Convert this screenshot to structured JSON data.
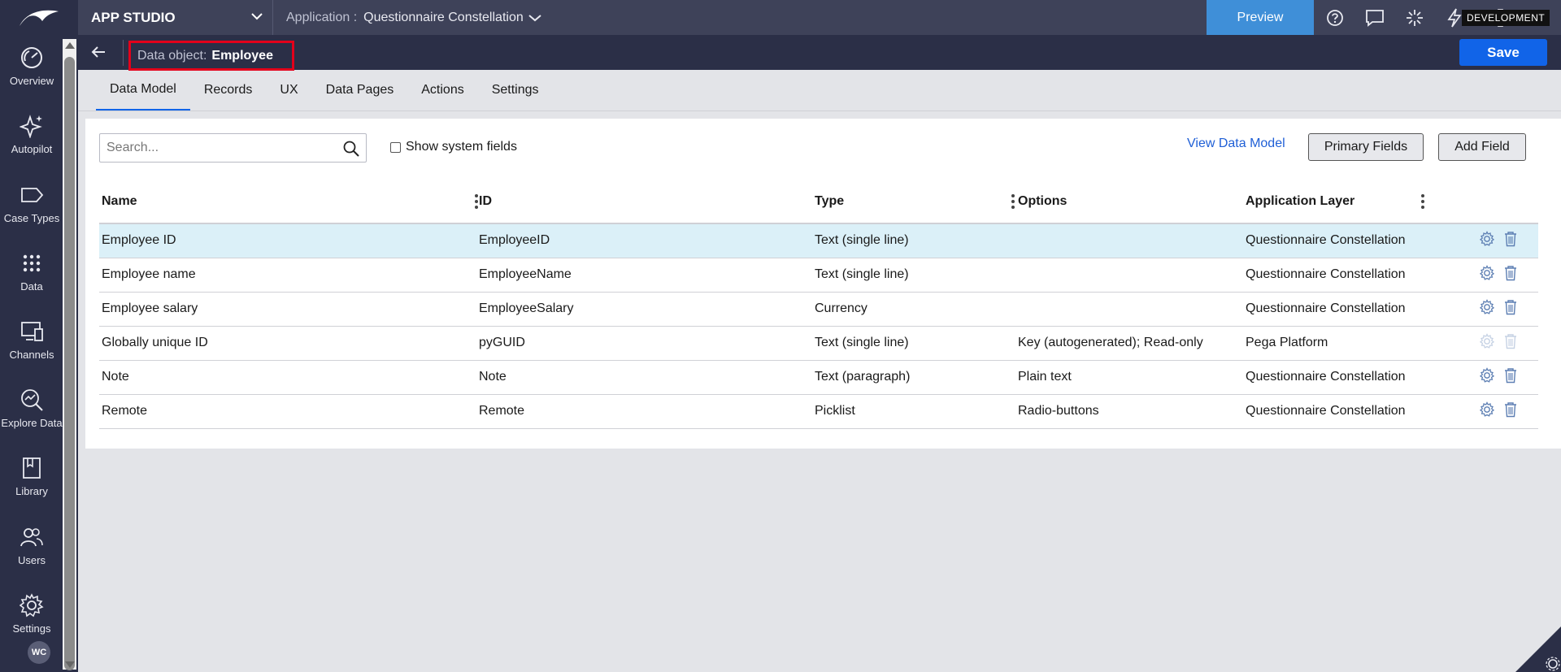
{
  "leftnav": {
    "items": [
      {
        "label": "Overview",
        "icon": "overview-icon"
      },
      {
        "label": "Autopilot",
        "icon": "sparkle-icon"
      },
      {
        "label": "Case Types",
        "icon": "case-type-icon"
      },
      {
        "label": "Data",
        "icon": "data-grid-icon"
      },
      {
        "label": "Channels",
        "icon": "channels-icon"
      },
      {
        "label": "Explore Data",
        "icon": "explore-data-icon"
      },
      {
        "label": "Library",
        "icon": "library-icon"
      },
      {
        "label": "Users",
        "icon": "users-icon"
      },
      {
        "label": "Settings",
        "icon": "settings-icon"
      }
    ],
    "avatar": "WC"
  },
  "header": {
    "studio": "APP STUDIO",
    "application_label": "Application :",
    "application_name": "Questionnaire Constellation",
    "preview": "Preview",
    "environment": "DEVELOPMENT"
  },
  "subheader": {
    "object_label": "Data object:",
    "object_name": "Employee",
    "save": "Save"
  },
  "tabs": [
    "Data Model",
    "Records",
    "UX",
    "Data Pages",
    "Actions",
    "Settings"
  ],
  "toolbar": {
    "search_placeholder": "Search...",
    "show_system_fields": "Show system fields",
    "view_data_model": "View Data Model",
    "primary_fields": "Primary Fields",
    "add_field": "Add Field"
  },
  "table": {
    "columns": [
      "Name",
      "ID",
      "Type",
      "Options",
      "Application Layer"
    ],
    "rows": [
      {
        "name": "Employee ID",
        "id": "EmployeeID",
        "type": "Text (single line)",
        "options": "",
        "layer": "Questionnaire Constellation"
      },
      {
        "name": "Employee name",
        "id": "EmployeeName",
        "type": "Text (single line)",
        "options": "",
        "layer": "Questionnaire Constellation"
      },
      {
        "name": "Employee salary",
        "id": "EmployeeSalary",
        "type": "Currency",
        "options": "",
        "layer": "Questionnaire Constellation"
      },
      {
        "name": "Globally unique ID",
        "id": "pyGUID",
        "type": "Text (single line)",
        "options": "Key (autogenerated); Read-only",
        "layer": "Pega Platform"
      },
      {
        "name": "Note",
        "id": "Note",
        "type": "Text (paragraph)",
        "options": "Plain text",
        "layer": "Questionnaire Constellation"
      },
      {
        "name": "Remote",
        "id": "Remote",
        "type": "Picklist",
        "options": "Radio-buttons",
        "layer": "Questionnaire Constellation"
      }
    ]
  }
}
